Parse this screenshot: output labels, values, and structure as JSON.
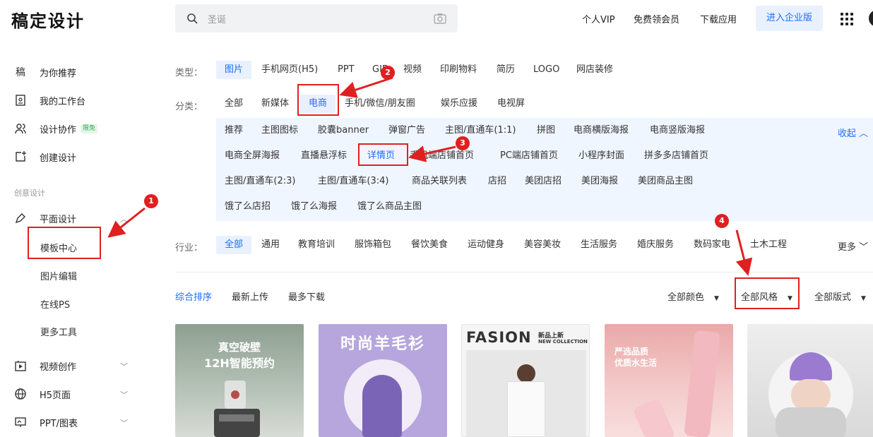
{
  "header": {
    "logo": "稿定设计",
    "search_placeholder": "圣诞",
    "nav": [
      "个人VIP",
      "免费领会员",
      "下载应用"
    ],
    "enterprise": "进入企业版"
  },
  "sidebar": {
    "items": [
      {
        "icon": "gao-icon",
        "label": "为你推荐"
      },
      {
        "icon": "workspace-icon",
        "label": "我的工作台"
      },
      {
        "icon": "users-icon",
        "label": "设计协作",
        "badge": "限免"
      },
      {
        "icon": "create-icon",
        "label": "创建设计"
      }
    ],
    "section": "创意设计",
    "graphic": "平面设计",
    "graphic_sub": [
      "模板中心",
      "图片编辑",
      "在线PS",
      "更多工具"
    ],
    "groups": [
      "视频创作",
      "H5页面",
      "PPT/图表"
    ]
  },
  "filters": {
    "type_label": "类型：",
    "types": [
      "图片",
      "手机网页(H5)",
      "PPT",
      "GIF",
      "视频",
      "印刷物料",
      "简历",
      "LOGO",
      "网店装修"
    ],
    "category_label": "分类：",
    "categories": [
      "全部",
      "新媒体",
      "电商",
      "手机/微信/朋友圈",
      "娱乐应援",
      "电视屏"
    ],
    "sub_rows": [
      [
        "推荐",
        "主图图标",
        "胶囊banner",
        "弹窗广告",
        "主图/直通车(1:1)",
        "拼图",
        "电商横版海报",
        "电商竖版海报"
      ],
      [
        "电商全屏海报",
        "直播悬浮标",
        "详情页",
        "手机端店铺首页",
        "PC端店铺首页",
        "小程序封面",
        "拼多多店铺首页"
      ],
      [
        "主图/直通车(2:3)",
        "主图/直通车(3:4)",
        "商品关联列表",
        "店招",
        "美团店招",
        "美团海报",
        "美团商品主图"
      ],
      [
        "饿了么店招",
        "饿了么海报",
        "饿了么商品主图"
      ]
    ],
    "collapse": "收起",
    "industry_label": "行业：",
    "industries": [
      "全部",
      "通用",
      "教育培训",
      "服饰箱包",
      "餐饮美食",
      "运动健身",
      "美容美妆",
      "生活服务",
      "婚庆服务",
      "数码家电",
      "土木工程"
    ],
    "more": "更多"
  },
  "sort": {
    "options": [
      "综合排序",
      "最新上传",
      "最多下载"
    ],
    "dropdowns": [
      "全部颜色",
      "全部风格",
      "全部版式"
    ]
  },
  "cards": {
    "c1_line1": "真空破壁",
    "c1_line2": "12H智能预约",
    "c2_title": "时尚羊毛衫",
    "c3_title": "FASION",
    "c3_tag1": "新品上新",
    "c3_tag2": "NEW COLLECTION",
    "c4_line1": "严选品质",
    "c4_line2": "优质水生活"
  },
  "annotations": [
    "1",
    "2",
    "3",
    "4"
  ],
  "colors": {
    "accent": "#1f6bff",
    "annotation": "#e02020"
  }
}
